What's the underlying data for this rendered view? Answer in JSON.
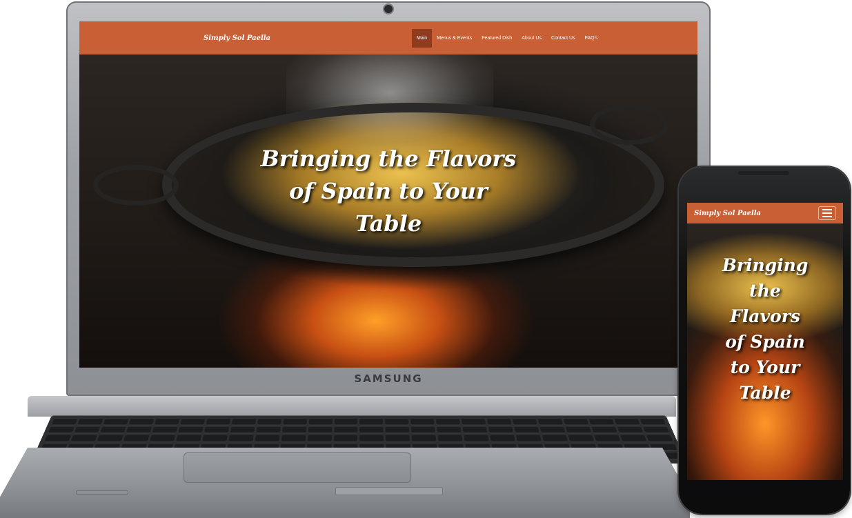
{
  "laptop": {
    "brand": "SAMSUNG"
  },
  "site": {
    "logo": "Simply Sol Paella",
    "nav": [
      {
        "label": "Main",
        "active": true
      },
      {
        "label": "Menus & Events",
        "active": false
      },
      {
        "label": "Featured Dish",
        "active": false
      },
      {
        "label": "About Us",
        "active": false
      },
      {
        "label": "Contact Us",
        "active": false
      },
      {
        "label": "FAQ's",
        "active": false
      }
    ],
    "hero_lines": [
      "Bringing the Flavors",
      "of Spain to Your",
      "Table"
    ]
  },
  "mobile": {
    "logo": "Simply Sol Paella",
    "menu_icon": "hamburger-menu-icon",
    "hero_lines": [
      "Bringing",
      "the",
      "Flavors",
      "of Spain",
      "to Your",
      "Table"
    ]
  },
  "colors": {
    "nav_bg": "#c95f35",
    "nav_active": "#8f3c1e"
  }
}
